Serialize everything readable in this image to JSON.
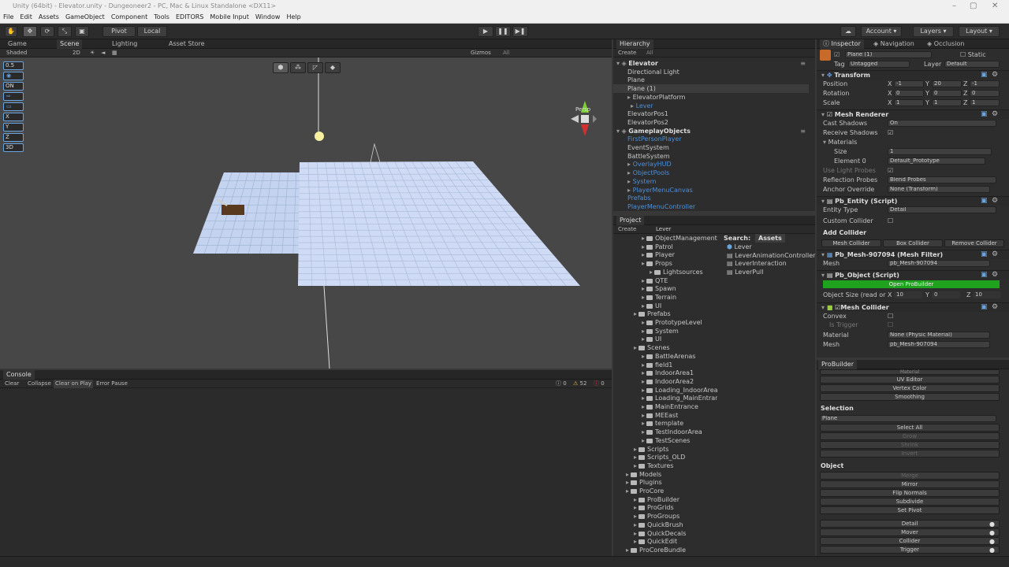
{
  "window": {
    "title": "Unity (64bit) - Elevator.unity - Dungeoneer2 - PC, Mac & Linux Standalone <DX11>"
  },
  "menu": [
    "File",
    "Edit",
    "Assets",
    "GameObject",
    "Component",
    "Tools",
    "EDITORS",
    "Mobile Input",
    "Window",
    "Help"
  ],
  "toolbar": {
    "pivot": "Pivot",
    "local": "Local",
    "account": "Account",
    "layers": "Layers",
    "layout": "Layout"
  },
  "scene": {
    "tabs": [
      "Game",
      "Scene",
      "Lighting",
      "Asset Store"
    ],
    "shading": "Shaded",
    "mode2d": "2D",
    "gizmos": "Gizmos",
    "search": "All",
    "persp": "Persp",
    "side_buttons": [
      "0.5",
      "",
      "ON",
      "",
      "",
      "X",
      "Y",
      "Z",
      "3D"
    ]
  },
  "console": {
    "tab": "Console",
    "buttons": [
      "Clear",
      "Collapse",
      "Clear on Play",
      "Error Pause"
    ],
    "counts": [
      "0",
      "52",
      "0"
    ]
  },
  "hierarchy": {
    "tab": "Hierarchy",
    "create": "Create",
    "search": "All",
    "items": [
      {
        "label": "Elevator",
        "style": "root"
      },
      {
        "label": "Directional Light",
        "style": "child"
      },
      {
        "label": "Plane",
        "style": "child"
      },
      {
        "label": "Plane (1)",
        "style": "child-selected"
      },
      {
        "label": "ElevatorPlatform",
        "style": "child-fold"
      },
      {
        "label": "Lever",
        "style": "grandchild-blue"
      },
      {
        "label": "ElevatorPos1",
        "style": "child"
      },
      {
        "label": "ElevatorPos2",
        "style": "child"
      },
      {
        "label": "GameplayObjects",
        "style": "root"
      },
      {
        "label": "FirstPersonPlayer",
        "style": "child-blue"
      },
      {
        "label": "EventSystem",
        "style": "child"
      },
      {
        "label": "BattleSystem",
        "style": "child"
      },
      {
        "label": "OverlayHUD",
        "style": "child-blue-fold"
      },
      {
        "label": "ObjectPools",
        "style": "child-blue-fold"
      },
      {
        "label": "System",
        "style": "child-blue-fold"
      },
      {
        "label": "PlayerMenuCanvas",
        "style": "child-blue-fold"
      },
      {
        "label": "Prefabs",
        "style": "child-blue"
      },
      {
        "label": "PlayerMenuController",
        "style": "child-blue"
      }
    ]
  },
  "project": {
    "tab": "Project",
    "create": "Create",
    "search": "Lever",
    "search_label": "Search:",
    "assets_label": "Assets",
    "tree": [
      {
        "label": "ObjectManagement",
        "indent": 3
      },
      {
        "label": "Patrol",
        "indent": 3
      },
      {
        "label": "Player",
        "indent": 3
      },
      {
        "label": "Props",
        "indent": 3
      },
      {
        "label": "Lightsources",
        "indent": 4
      },
      {
        "label": "QTE",
        "indent": 3
      },
      {
        "label": "Spawn",
        "indent": 3
      },
      {
        "label": "Terrain",
        "indent": 3
      },
      {
        "label": "UI",
        "indent": 3
      },
      {
        "label": "Prefabs",
        "indent": 2
      },
      {
        "label": "PrototypeLevel",
        "indent": 3
      },
      {
        "label": "System",
        "indent": 3
      },
      {
        "label": "UI",
        "indent": 3
      },
      {
        "label": "Scenes",
        "indent": 2
      },
      {
        "label": "BattleArenas",
        "indent": 3
      },
      {
        "label": "field1",
        "indent": 3
      },
      {
        "label": "IndoorArea1",
        "indent": 3
      },
      {
        "label": "IndoorArea2",
        "indent": 3
      },
      {
        "label": "Loading_IndoorArea",
        "indent": 3
      },
      {
        "label": "Loading_MainEntran",
        "indent": 3
      },
      {
        "label": "MainEntrance",
        "indent": 3
      },
      {
        "label": "MEEast",
        "indent": 3
      },
      {
        "label": "template",
        "indent": 3
      },
      {
        "label": "TestIndoorArea",
        "indent": 3
      },
      {
        "label": "TestScenes",
        "indent": 3
      },
      {
        "label": "Scripts",
        "indent": 2
      },
      {
        "label": "Scripts_OLD",
        "indent": 2
      },
      {
        "label": "Textures",
        "indent": 2
      },
      {
        "label": "Models",
        "indent": 1
      },
      {
        "label": "Plugins",
        "indent": 1
      },
      {
        "label": "ProCore",
        "indent": 1
      },
      {
        "label": "ProBuilder",
        "indent": 2
      },
      {
        "label": "ProGrids",
        "indent": 2
      },
      {
        "label": "ProGroups",
        "indent": 2
      },
      {
        "label": "QuickBrush",
        "indent": 2
      },
      {
        "label": "QuickDecals",
        "indent": 2
      },
      {
        "label": "QuickEdit",
        "indent": 2
      },
      {
        "label": "ProCoreBundle",
        "indent": 1
      }
    ],
    "results": [
      "Lever",
      "LeverAnimationController",
      "LeverInteraction",
      "LeverPull"
    ]
  },
  "inspector": {
    "tabs": [
      "Inspector",
      "Navigation",
      "Occlusion"
    ],
    "object_name": "Plane (1)",
    "static_label": "Static",
    "tag_label": "Tag",
    "tag_value": "Untagged",
    "layer_label": "Layer",
    "layer_value": "Default",
    "transform": {
      "title": "Transform",
      "position": {
        "label": "Position",
        "x": "-1",
        "y": "20",
        "z": "-1"
      },
      "rotation": {
        "label": "Rotation",
        "x": "0",
        "y": "0",
        "z": "0"
      },
      "scale": {
        "label": "Scale",
        "x": "1",
        "y": "1",
        "z": "1"
      }
    },
    "mesh_renderer": {
      "title": "Mesh Renderer",
      "cast_shadows": "Cast Shadows",
      "cast_shadows_value": "On",
      "receive_shadows": "Receive Shadows",
      "materials": "Materials",
      "size": "Size",
      "size_value": "1",
      "element0": "Element 0",
      "element0_value": "Default_Prototype",
      "use_light_probes": "Use Light Probes",
      "reflection_probes": "Reflection Probes",
      "reflection_probes_value": "Blend Probes",
      "anchor_override": "Anchor Override",
      "anchor_override_value": "None (Transform)"
    },
    "pb_entity": {
      "title": "Pb_Entity (Script)",
      "entity_type": "Entity Type",
      "entity_type_value": "Detail",
      "custom_collider": "Custom Collider",
      "add_collider": "Add Collider",
      "buttons": [
        "Mesh Collider",
        "Box Collider",
        "Remove Collider"
      ]
    },
    "mesh_filter": {
      "title": "Pb_Mesh-907094 (Mesh Filter)",
      "mesh": "Mesh",
      "mesh_value": "pb_Mesh-907094"
    },
    "pb_object": {
      "title": "Pb_Object (Script)",
      "open": "Open ProBuilder",
      "size_label": "Object Size (read or",
      "x": "10",
      "y": "0",
      "z": "10"
    },
    "mesh_collider": {
      "title": "Mesh Collider",
      "convex": "Convex",
      "is_trigger": "Is Trigger",
      "material": "Material",
      "material_value": "None (Physic Material)",
      "mesh": "Mesh",
      "mesh_value": "pb_Mesh-907094"
    }
  },
  "probuilder": {
    "tab": "ProBuilder",
    "top": [
      "Material",
      "UV Editor",
      "Vertex Color",
      "Smoothing"
    ],
    "selection_label": "Selection",
    "selection_value": "Plane",
    "selection_buttons": [
      "Select All",
      "Grow",
      "Shrink",
      "Invert"
    ],
    "object_label": "Object",
    "object_buttons": [
      "Merge",
      "Mirror",
      "Flip Normals",
      "Subdivide",
      "Set Pivot"
    ],
    "entity_buttons": [
      "Detail",
      "Mover",
      "Collider",
      "Trigger"
    ]
  },
  "colors": {
    "accent_green": "#1fa31f",
    "selection_blue": "#4d8fd8",
    "plane": "#c5d6f2"
  }
}
